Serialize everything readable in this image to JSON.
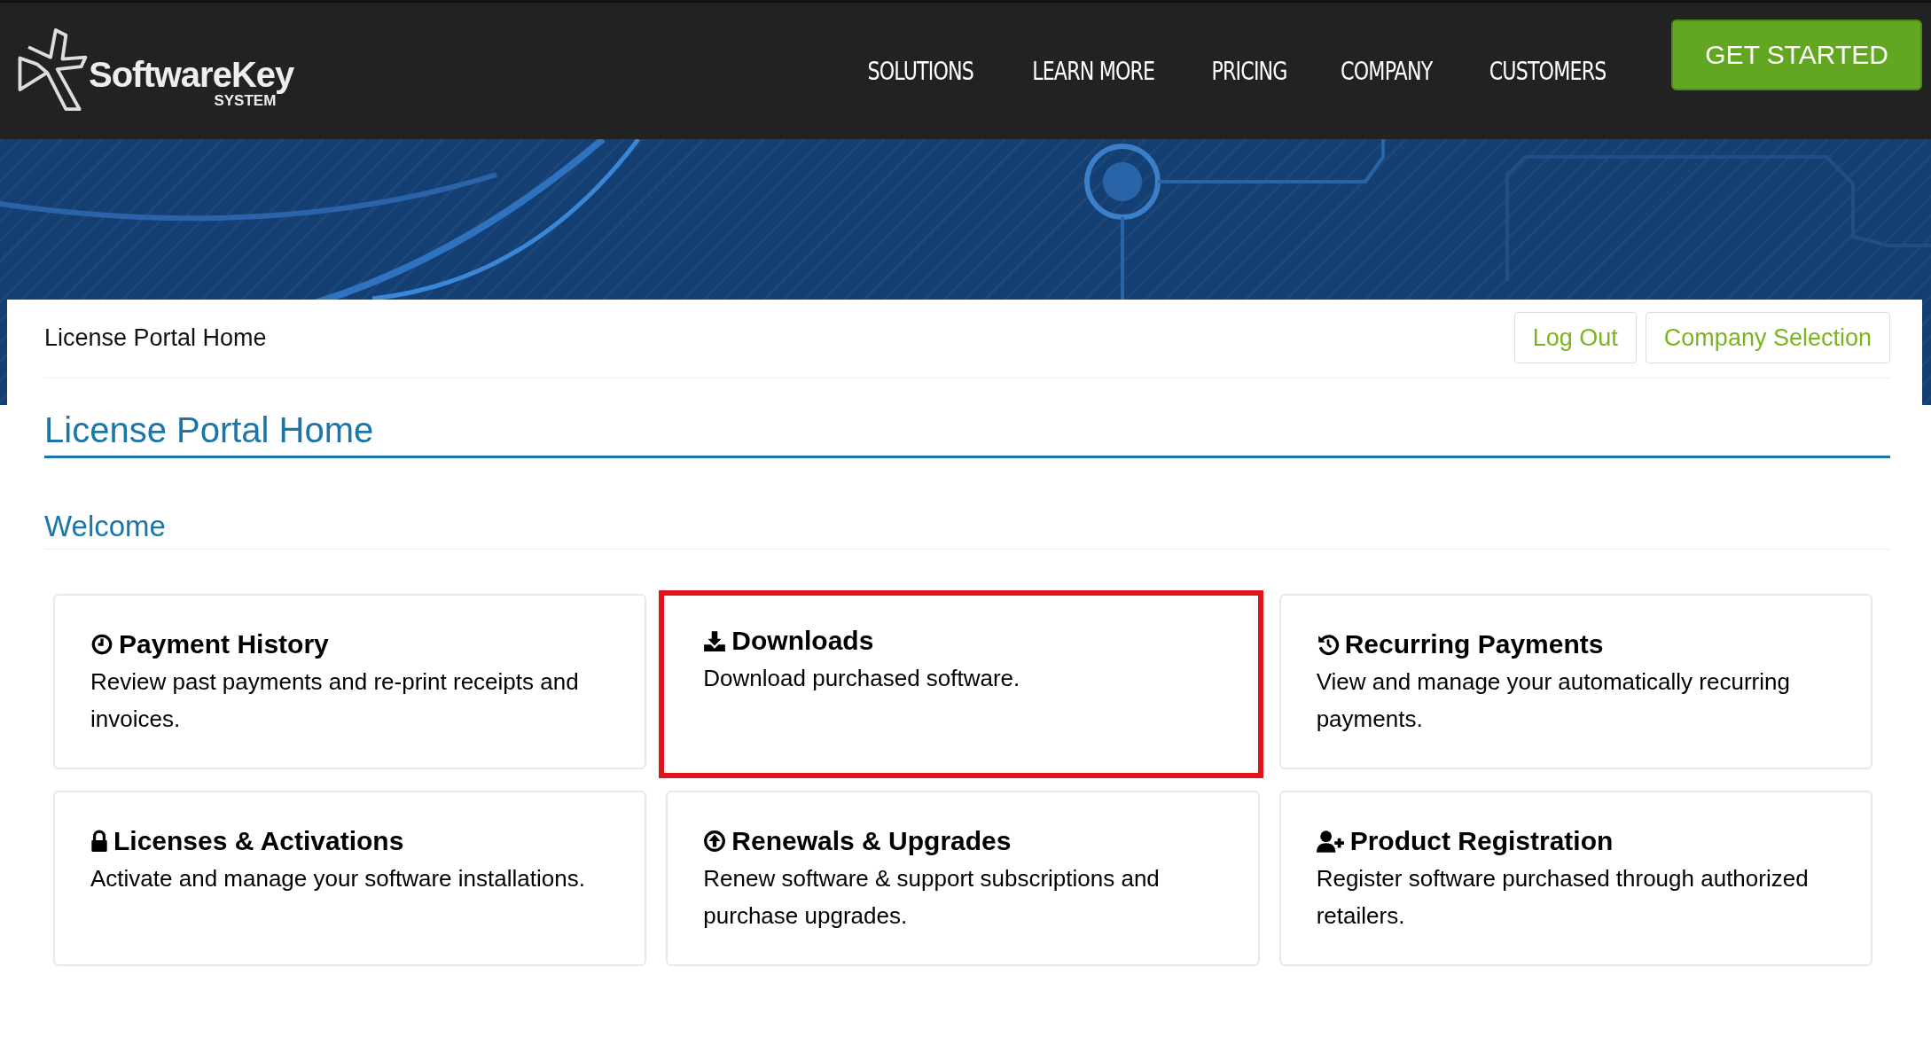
{
  "header": {
    "logo": {
      "name": "SoftwareKey",
      "subtitle": "SYSTEM"
    },
    "nav": [
      {
        "label": "SOLUTIONS"
      },
      {
        "label": "LEARN MORE"
      },
      {
        "label": "PRICING"
      },
      {
        "label": "COMPANY"
      },
      {
        "label": "CUSTOMERS"
      }
    ],
    "cta": "GET STARTED"
  },
  "breadcrumb": "License Portal Home",
  "actions": [
    "Log Out",
    "Company Selection"
  ],
  "page_title": "License Portal Home",
  "section_title": "Welcome",
  "cards": [
    {
      "kind": "clock",
      "title": "Payment History",
      "text": "Review past payments and re-print receipts and invoices.",
      "highlighted": false
    },
    {
      "kind": "download",
      "title": "Downloads",
      "text": "Download purchased software.",
      "highlighted": true
    },
    {
      "kind": "history",
      "title": "Recurring Payments",
      "text": "View and manage your automatically recurring payments.",
      "highlighted": false
    },
    {
      "kind": "lock",
      "title": "Licenses & Activations",
      "text": "Activate and manage your software installations.",
      "highlighted": false
    },
    {
      "kind": "upload",
      "title": "Renewals & Upgrades",
      "text": "Renew software & support subscriptions and purchase upgrades.",
      "highlighted": false
    },
    {
      "kind": "userplus",
      "title": "Product Registration",
      "text": "Register software purchased through authorized retailers.",
      "highlighted": false
    }
  ]
}
